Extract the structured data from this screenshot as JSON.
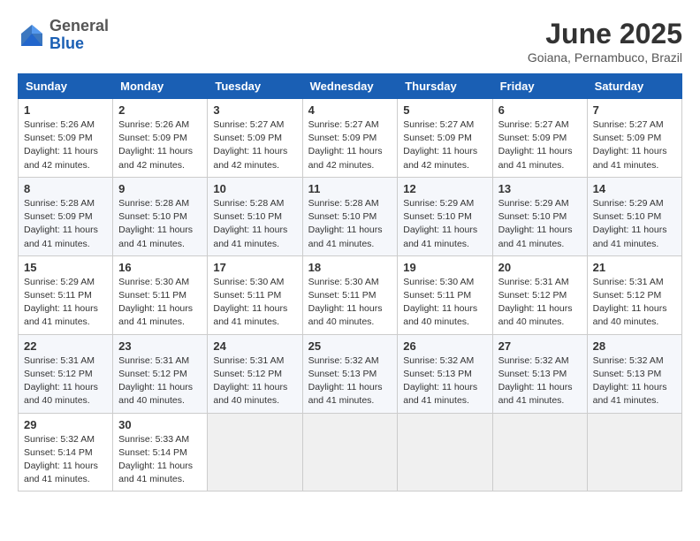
{
  "header": {
    "logo_general": "General",
    "logo_blue": "Blue",
    "month_title": "June 2025",
    "location": "Goiana, Pernambuco, Brazil"
  },
  "weekdays": [
    "Sunday",
    "Monday",
    "Tuesday",
    "Wednesday",
    "Thursday",
    "Friday",
    "Saturday"
  ],
  "weeks": [
    [
      {
        "day": "1",
        "info": "Sunrise: 5:26 AM\nSunset: 5:09 PM\nDaylight: 11 hours and 42 minutes."
      },
      {
        "day": "2",
        "info": "Sunrise: 5:26 AM\nSunset: 5:09 PM\nDaylight: 11 hours and 42 minutes."
      },
      {
        "day": "3",
        "info": "Sunrise: 5:27 AM\nSunset: 5:09 PM\nDaylight: 11 hours and 42 minutes."
      },
      {
        "day": "4",
        "info": "Sunrise: 5:27 AM\nSunset: 5:09 PM\nDaylight: 11 hours and 42 minutes."
      },
      {
        "day": "5",
        "info": "Sunrise: 5:27 AM\nSunset: 5:09 PM\nDaylight: 11 hours and 42 minutes."
      },
      {
        "day": "6",
        "info": "Sunrise: 5:27 AM\nSunset: 5:09 PM\nDaylight: 11 hours and 41 minutes."
      },
      {
        "day": "7",
        "info": "Sunrise: 5:27 AM\nSunset: 5:09 PM\nDaylight: 11 hours and 41 minutes."
      }
    ],
    [
      {
        "day": "8",
        "info": "Sunrise: 5:28 AM\nSunset: 5:09 PM\nDaylight: 11 hours and 41 minutes."
      },
      {
        "day": "9",
        "info": "Sunrise: 5:28 AM\nSunset: 5:10 PM\nDaylight: 11 hours and 41 minutes."
      },
      {
        "day": "10",
        "info": "Sunrise: 5:28 AM\nSunset: 5:10 PM\nDaylight: 11 hours and 41 minutes."
      },
      {
        "day": "11",
        "info": "Sunrise: 5:28 AM\nSunset: 5:10 PM\nDaylight: 11 hours and 41 minutes."
      },
      {
        "day": "12",
        "info": "Sunrise: 5:29 AM\nSunset: 5:10 PM\nDaylight: 11 hours and 41 minutes."
      },
      {
        "day": "13",
        "info": "Sunrise: 5:29 AM\nSunset: 5:10 PM\nDaylight: 11 hours and 41 minutes."
      },
      {
        "day": "14",
        "info": "Sunrise: 5:29 AM\nSunset: 5:10 PM\nDaylight: 11 hours and 41 minutes."
      }
    ],
    [
      {
        "day": "15",
        "info": "Sunrise: 5:29 AM\nSunset: 5:11 PM\nDaylight: 11 hours and 41 minutes."
      },
      {
        "day": "16",
        "info": "Sunrise: 5:30 AM\nSunset: 5:11 PM\nDaylight: 11 hours and 41 minutes."
      },
      {
        "day": "17",
        "info": "Sunrise: 5:30 AM\nSunset: 5:11 PM\nDaylight: 11 hours and 41 minutes."
      },
      {
        "day": "18",
        "info": "Sunrise: 5:30 AM\nSunset: 5:11 PM\nDaylight: 11 hours and 40 minutes."
      },
      {
        "day": "19",
        "info": "Sunrise: 5:30 AM\nSunset: 5:11 PM\nDaylight: 11 hours and 40 minutes."
      },
      {
        "day": "20",
        "info": "Sunrise: 5:31 AM\nSunset: 5:12 PM\nDaylight: 11 hours and 40 minutes."
      },
      {
        "day": "21",
        "info": "Sunrise: 5:31 AM\nSunset: 5:12 PM\nDaylight: 11 hours and 40 minutes."
      }
    ],
    [
      {
        "day": "22",
        "info": "Sunrise: 5:31 AM\nSunset: 5:12 PM\nDaylight: 11 hours and 40 minutes."
      },
      {
        "day": "23",
        "info": "Sunrise: 5:31 AM\nSunset: 5:12 PM\nDaylight: 11 hours and 40 minutes."
      },
      {
        "day": "24",
        "info": "Sunrise: 5:31 AM\nSunset: 5:12 PM\nDaylight: 11 hours and 40 minutes."
      },
      {
        "day": "25",
        "info": "Sunrise: 5:32 AM\nSunset: 5:13 PM\nDaylight: 11 hours and 41 minutes."
      },
      {
        "day": "26",
        "info": "Sunrise: 5:32 AM\nSunset: 5:13 PM\nDaylight: 11 hours and 41 minutes."
      },
      {
        "day": "27",
        "info": "Sunrise: 5:32 AM\nSunset: 5:13 PM\nDaylight: 11 hours and 41 minutes."
      },
      {
        "day": "28",
        "info": "Sunrise: 5:32 AM\nSunset: 5:13 PM\nDaylight: 11 hours and 41 minutes."
      }
    ],
    [
      {
        "day": "29",
        "info": "Sunrise: 5:32 AM\nSunset: 5:14 PM\nDaylight: 11 hours and 41 minutes."
      },
      {
        "day": "30",
        "info": "Sunrise: 5:33 AM\nSunset: 5:14 PM\nDaylight: 11 hours and 41 minutes."
      },
      {
        "day": "",
        "info": ""
      },
      {
        "day": "",
        "info": ""
      },
      {
        "day": "",
        "info": ""
      },
      {
        "day": "",
        "info": ""
      },
      {
        "day": "",
        "info": ""
      }
    ]
  ]
}
